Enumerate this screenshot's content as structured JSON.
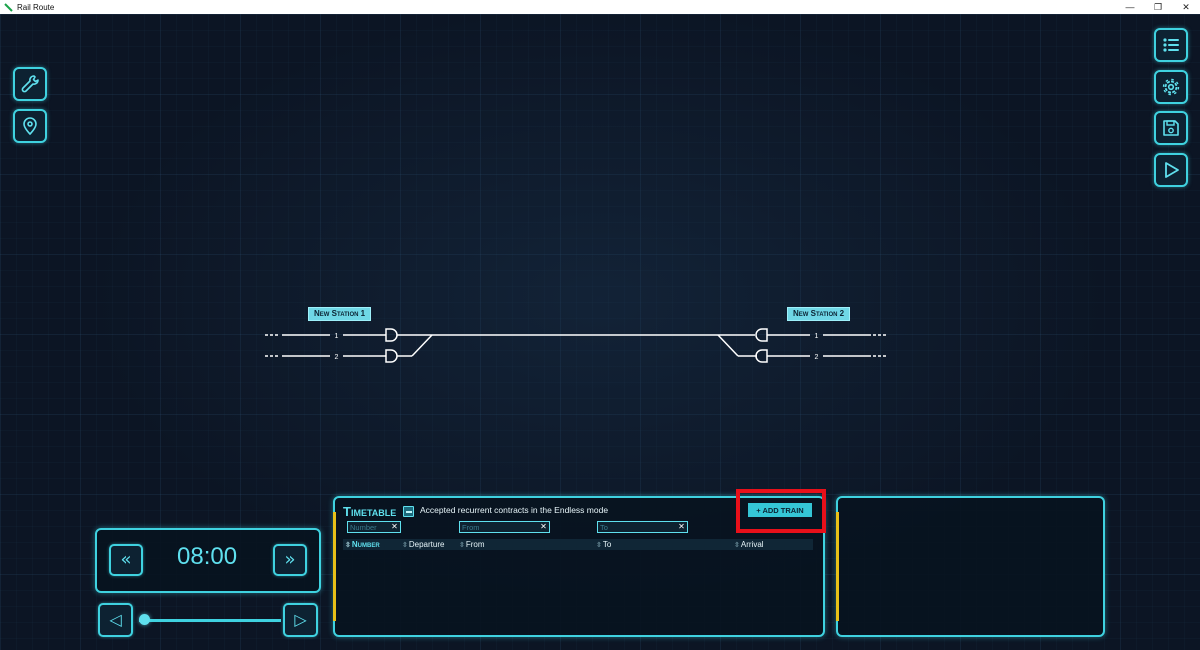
{
  "window": {
    "title": "Rail Route",
    "controls": {
      "minimize": "—",
      "restore": "❐",
      "close": "✕"
    }
  },
  "left_toolbar": [
    {
      "name": "wrench-icon",
      "label": ""
    },
    {
      "name": "map-pin-icon",
      "label": ""
    }
  ],
  "right_toolbar": [
    {
      "name": "list-icon"
    },
    {
      "name": "gear-icon"
    },
    {
      "name": "save-icon"
    },
    {
      "name": "play-icon"
    }
  ],
  "stations": [
    {
      "name": "New Station 1",
      "tracks": [
        "1",
        "2"
      ]
    },
    {
      "name": "New Station 2",
      "tracks": [
        "1",
        "2"
      ]
    }
  ],
  "timetable": {
    "title": "Timetable",
    "subtitle": "Accepted recurrent contracts in the Endless mode",
    "add_train_label": "+ ADD TRAIN",
    "filters": {
      "number_placeholder": "Number",
      "from_placeholder": "From",
      "to_placeholder": "To",
      "clear_glyph": "✕"
    },
    "columns": {
      "number": "Number",
      "departure": "Departure",
      "from": "From",
      "to": "To",
      "arrival": "Arrival"
    },
    "sort_glyph": "⇳"
  },
  "clock": {
    "time": "08:00",
    "rewind_glyph": "«",
    "fast_forward_glyph": "»",
    "step_back_glyph": "◁",
    "step_forward_glyph": "▷",
    "slider_position": 0
  },
  "colors": {
    "accent": "#3fd2e0",
    "highlight": "#e8101a",
    "panel_accent": "#e8c018",
    "background": "#0c1524"
  }
}
